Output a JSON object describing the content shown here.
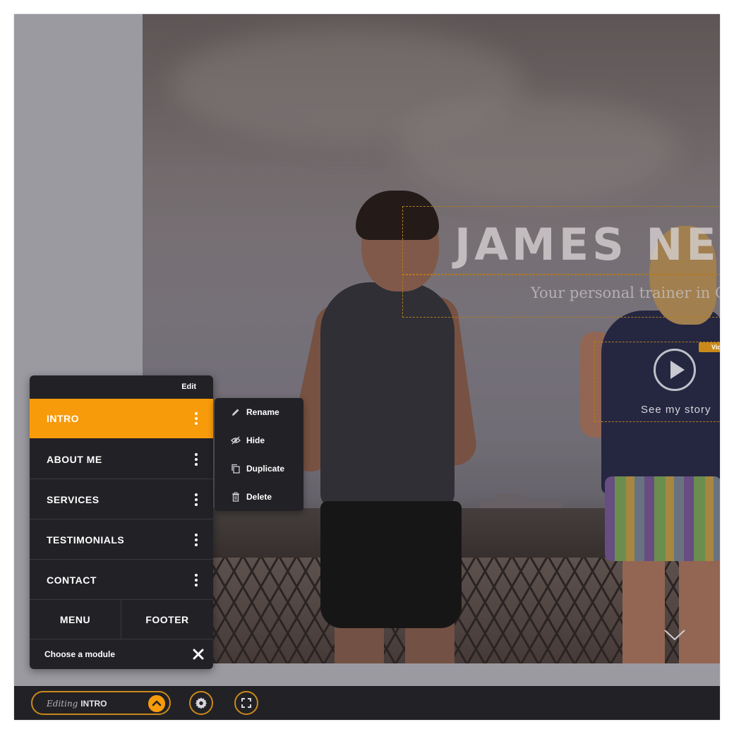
{
  "hero": {
    "title": "JAMES NE",
    "subtitle": "Your personal trainer in C",
    "video_tag": "Vid",
    "see_story": "See my story"
  },
  "panel": {
    "edit_label": "Edit",
    "modules": [
      {
        "label": "INTRO",
        "active": true
      },
      {
        "label": "ABOUT ME",
        "active": false
      },
      {
        "label": "SERVICES",
        "active": false
      },
      {
        "label": "TESTIMONIALS",
        "active": false
      },
      {
        "label": "CONTACT",
        "active": false
      }
    ],
    "menu_label": "MENU",
    "footer_label": "FOOTER",
    "choose_label": "Choose a module"
  },
  "context_menu": {
    "items": [
      {
        "label": "Rename",
        "icon": "pencil-icon"
      },
      {
        "label": "Hide",
        "icon": "eye-slash-icon"
      },
      {
        "label": "Duplicate",
        "icon": "duplicate-icon"
      },
      {
        "label": "Delete",
        "icon": "trash-icon"
      }
    ]
  },
  "bottom_bar": {
    "editing_prefix": "Editing",
    "editing_module": "INTRO"
  },
  "colors": {
    "accent": "#f79b0b",
    "accent_border": "#c98a1a",
    "panel_bg": "#222126",
    "canvas_bg": "#9b9aa1"
  }
}
